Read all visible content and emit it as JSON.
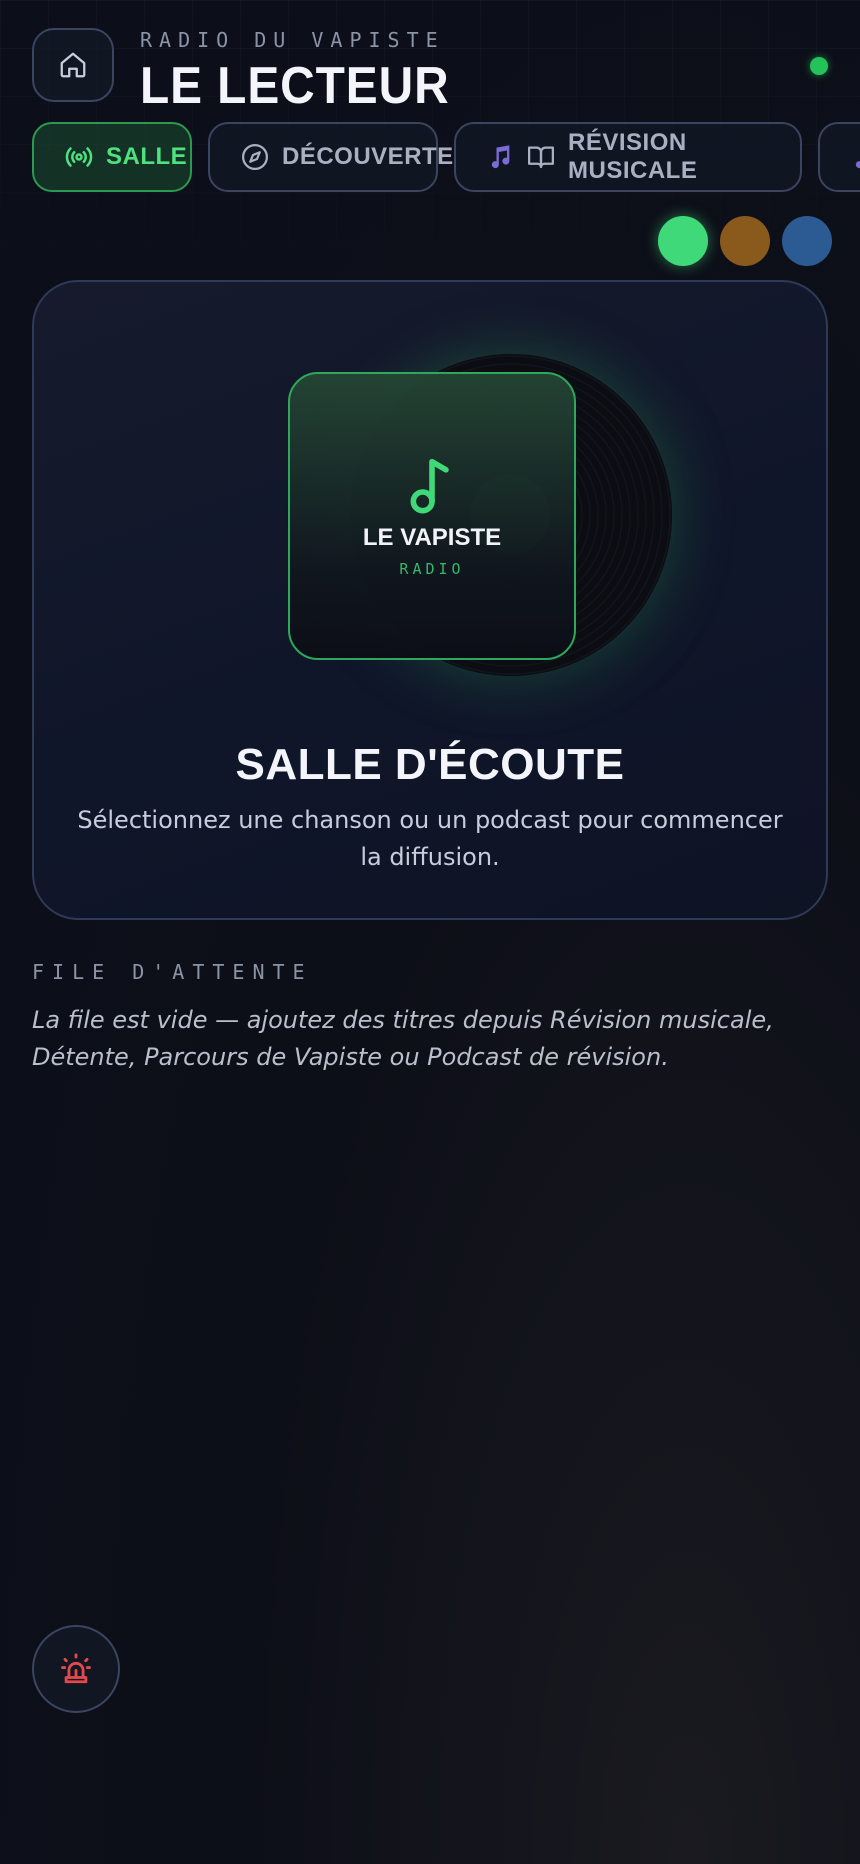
{
  "header": {
    "kicker": "RADIO DU VAPISTE",
    "title": "LE LECTEUR"
  },
  "tabs": [
    {
      "label": "SALLE",
      "icon": "broadcast-icon",
      "active": true
    },
    {
      "label": "DÉCOUVERTE",
      "icon": "compass-icon",
      "active": false
    },
    {
      "label": "RÉVISION MUSICALE",
      "icon": "book-open-icon",
      "active": false
    }
  ],
  "theme_dots": [
    "#3fd97a",
    "#8a5a1c",
    "#2c5a92"
  ],
  "now_playing": {
    "cover_title": "LE VAPISTE",
    "cover_subtitle": "RADIO",
    "title": "SALLE D'ÉCOUTE",
    "description": "Sélectionnez une chanson ou un podcast pour commencer la diffusion."
  },
  "queue": {
    "label": "FILE D'ATTENTE",
    "empty_text": "La file est vide — ajoutez des titres depuis Révision musicale, Détente, Parcours de Vapiste ou Podcast de révision."
  },
  "colors": {
    "accent_green": "#3fd97a",
    "alarm_red": "#e5484d",
    "purple": "#7c6bd6"
  }
}
